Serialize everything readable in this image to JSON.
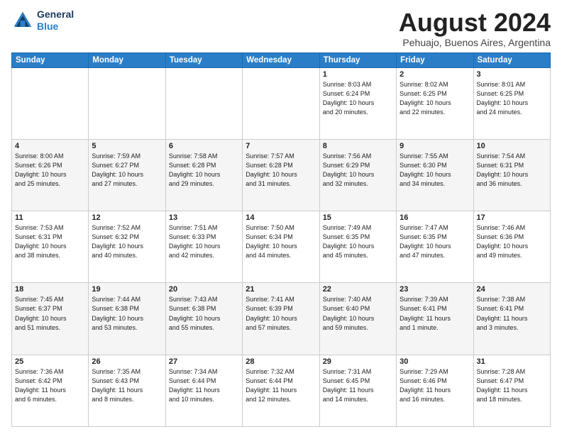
{
  "header": {
    "logo_line1": "General",
    "logo_line2": "Blue",
    "month_year": "August 2024",
    "location": "Pehuajo, Buenos Aires, Argentina"
  },
  "days_of_week": [
    "Sunday",
    "Monday",
    "Tuesday",
    "Wednesday",
    "Thursday",
    "Friday",
    "Saturday"
  ],
  "weeks": [
    [
      {
        "day": "",
        "info": ""
      },
      {
        "day": "",
        "info": ""
      },
      {
        "day": "",
        "info": ""
      },
      {
        "day": "",
        "info": ""
      },
      {
        "day": "1",
        "info": "Sunrise: 8:03 AM\nSunset: 6:24 PM\nDaylight: 10 hours\nand 20 minutes."
      },
      {
        "day": "2",
        "info": "Sunrise: 8:02 AM\nSunset: 6:25 PM\nDaylight: 10 hours\nand 22 minutes."
      },
      {
        "day": "3",
        "info": "Sunrise: 8:01 AM\nSunset: 6:25 PM\nDaylight: 10 hours\nand 24 minutes."
      }
    ],
    [
      {
        "day": "4",
        "info": "Sunrise: 8:00 AM\nSunset: 6:26 PM\nDaylight: 10 hours\nand 25 minutes."
      },
      {
        "day": "5",
        "info": "Sunrise: 7:59 AM\nSunset: 6:27 PM\nDaylight: 10 hours\nand 27 minutes."
      },
      {
        "day": "6",
        "info": "Sunrise: 7:58 AM\nSunset: 6:28 PM\nDaylight: 10 hours\nand 29 minutes."
      },
      {
        "day": "7",
        "info": "Sunrise: 7:57 AM\nSunset: 6:28 PM\nDaylight: 10 hours\nand 31 minutes."
      },
      {
        "day": "8",
        "info": "Sunrise: 7:56 AM\nSunset: 6:29 PM\nDaylight: 10 hours\nand 32 minutes."
      },
      {
        "day": "9",
        "info": "Sunrise: 7:55 AM\nSunset: 6:30 PM\nDaylight: 10 hours\nand 34 minutes."
      },
      {
        "day": "10",
        "info": "Sunrise: 7:54 AM\nSunset: 6:31 PM\nDaylight: 10 hours\nand 36 minutes."
      }
    ],
    [
      {
        "day": "11",
        "info": "Sunrise: 7:53 AM\nSunset: 6:31 PM\nDaylight: 10 hours\nand 38 minutes."
      },
      {
        "day": "12",
        "info": "Sunrise: 7:52 AM\nSunset: 6:32 PM\nDaylight: 10 hours\nand 40 minutes."
      },
      {
        "day": "13",
        "info": "Sunrise: 7:51 AM\nSunset: 6:33 PM\nDaylight: 10 hours\nand 42 minutes."
      },
      {
        "day": "14",
        "info": "Sunrise: 7:50 AM\nSunset: 6:34 PM\nDaylight: 10 hours\nand 44 minutes."
      },
      {
        "day": "15",
        "info": "Sunrise: 7:49 AM\nSunset: 6:35 PM\nDaylight: 10 hours\nand 45 minutes."
      },
      {
        "day": "16",
        "info": "Sunrise: 7:47 AM\nSunset: 6:35 PM\nDaylight: 10 hours\nand 47 minutes."
      },
      {
        "day": "17",
        "info": "Sunrise: 7:46 AM\nSunset: 6:36 PM\nDaylight: 10 hours\nand 49 minutes."
      }
    ],
    [
      {
        "day": "18",
        "info": "Sunrise: 7:45 AM\nSunset: 6:37 PM\nDaylight: 10 hours\nand 51 minutes."
      },
      {
        "day": "19",
        "info": "Sunrise: 7:44 AM\nSunset: 6:38 PM\nDaylight: 10 hours\nand 53 minutes."
      },
      {
        "day": "20",
        "info": "Sunrise: 7:43 AM\nSunset: 6:38 PM\nDaylight: 10 hours\nand 55 minutes."
      },
      {
        "day": "21",
        "info": "Sunrise: 7:41 AM\nSunset: 6:39 PM\nDaylight: 10 hours\nand 57 minutes."
      },
      {
        "day": "22",
        "info": "Sunrise: 7:40 AM\nSunset: 6:40 PM\nDaylight: 10 hours\nand 59 minutes."
      },
      {
        "day": "23",
        "info": "Sunrise: 7:39 AM\nSunset: 6:41 PM\nDaylight: 11 hours\nand 1 minute."
      },
      {
        "day": "24",
        "info": "Sunrise: 7:38 AM\nSunset: 6:41 PM\nDaylight: 11 hours\nand 3 minutes."
      }
    ],
    [
      {
        "day": "25",
        "info": "Sunrise: 7:36 AM\nSunset: 6:42 PM\nDaylight: 11 hours\nand 6 minutes."
      },
      {
        "day": "26",
        "info": "Sunrise: 7:35 AM\nSunset: 6:43 PM\nDaylight: 11 hours\nand 8 minutes."
      },
      {
        "day": "27",
        "info": "Sunrise: 7:34 AM\nSunset: 6:44 PM\nDaylight: 11 hours\nand 10 minutes."
      },
      {
        "day": "28",
        "info": "Sunrise: 7:32 AM\nSunset: 6:44 PM\nDaylight: 11 hours\nand 12 minutes."
      },
      {
        "day": "29",
        "info": "Sunrise: 7:31 AM\nSunset: 6:45 PM\nDaylight: 11 hours\nand 14 minutes."
      },
      {
        "day": "30",
        "info": "Sunrise: 7:29 AM\nSunset: 6:46 PM\nDaylight: 11 hours\nand 16 minutes."
      },
      {
        "day": "31",
        "info": "Sunrise: 7:28 AM\nSunset: 6:47 PM\nDaylight: 11 hours\nand 18 minutes."
      }
    ]
  ]
}
